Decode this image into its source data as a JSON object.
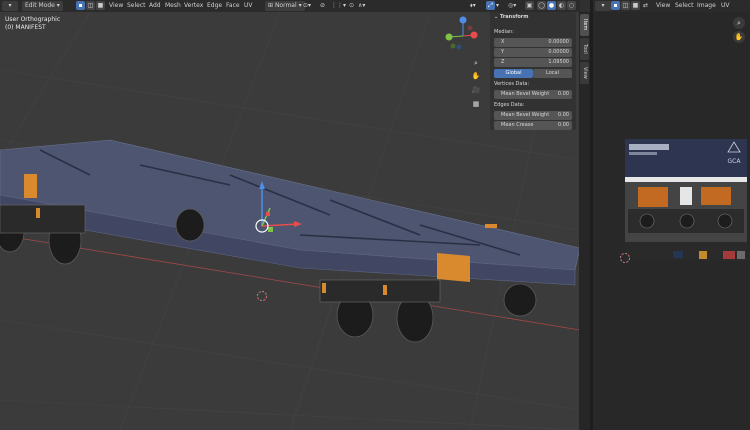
{
  "viewport": {
    "header": {
      "mode": "Edit Mode",
      "menu": [
        "View",
        "Select",
        "Add",
        "Mesh",
        "Vertex",
        "Edge",
        "Face",
        "UV"
      ],
      "orientation": "Normal"
    },
    "overlay": {
      "view_name": "User Orthographic",
      "object_name": "(0) MANIFEST"
    },
    "gizmo": {
      "x": "X",
      "y": "Y",
      "z": "Z"
    }
  },
  "npanel": {
    "title": "Transform",
    "median_label": "Median:",
    "fields": [
      {
        "axis": "X",
        "value": "0.00000"
      },
      {
        "axis": "Y",
        "value": "0.00000"
      },
      {
        "axis": "Z",
        "value": "1.09500"
      }
    ],
    "global_label": "Global",
    "local_label": "Local",
    "vertices_data_label": "Vertices Data:",
    "mean_bevel_weight_label": "Mean Bevel Weight",
    "vertex_bevel_value": "0.00",
    "edges_data_label": "Edges Data:",
    "edge_bevel_label": "Mean Bevel Weight",
    "edge_bevel_value": "0.00",
    "mean_crease_label": "Mean Crease",
    "mean_crease_value": "0.00",
    "tabs": [
      "Item",
      "Tool",
      "View"
    ]
  },
  "uv_editor": {
    "menu": [
      "View",
      "Select",
      "Image",
      "UV"
    ],
    "texture_logo_text": "GCA"
  },
  "colors": {
    "accent": "#4772b3",
    "background": "#3b3b3b",
    "axis_x": "#e84c4c",
    "axis_y": "#7fc248",
    "axis_z": "#4f8ee6",
    "orange_panel": "#d98a2e"
  }
}
